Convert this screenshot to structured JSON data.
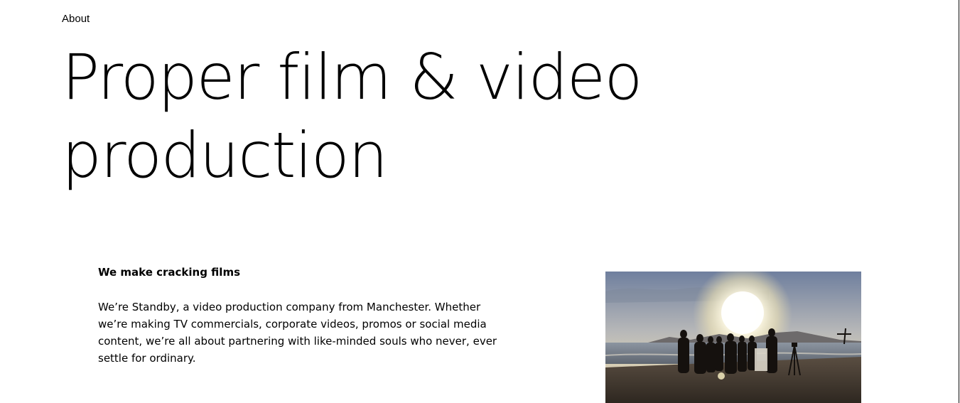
{
  "eyebrow": "About",
  "hero": {
    "line1": "Proper film & video",
    "line2": "production"
  },
  "intro": {
    "heading": "We make cracking films",
    "body": "We’re Standby, a video production company from Manchester. Whether we’re making TV commercials, corporate videos, promos or social media content, we’re all about partnering with like-minded souls who never, ever settle for ordinary."
  },
  "colors": {
    "text": "#000000",
    "background": "#ffffff"
  }
}
